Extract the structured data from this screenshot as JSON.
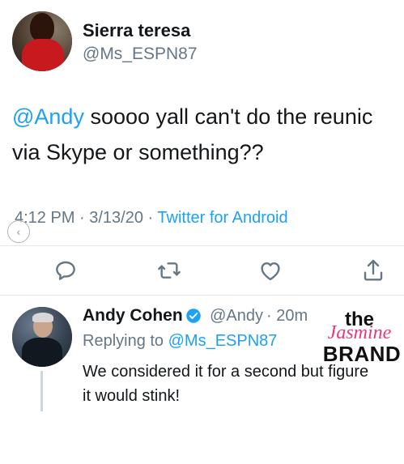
{
  "tweet": {
    "author_name": "Sierra teresa",
    "author_handle": "@Ms_ESPN87",
    "mention": "@Andy",
    "text_line1": " soooo yall can't do the reunic",
    "text_line2": "via Skype or something??",
    "timestamp": "4:12 PM · 3/13/20 · ",
    "source": "Twitter for Android"
  },
  "actions": {
    "reply_icon": "comment-icon",
    "retweet_icon": "retweet-icon",
    "like_icon": "heart-icon",
    "share_icon": "share-icon"
  },
  "reply": {
    "author_name": "Andy Cohen",
    "author_handle": "@Andy",
    "time": "· 20m",
    "replying_prefix": "Replying to ",
    "replying_to": "@Ms_ESPN87",
    "text_line1": "We considered it for a second but figure",
    "text_line2": "it would stink!"
  },
  "watermark": {
    "line1": "the",
    "line2": "Jasmine",
    "line3": "BRAND"
  },
  "colors": {
    "link": "#1da1f2",
    "secondary_text": "#657786",
    "watermark_pink": "#e23b7c"
  }
}
